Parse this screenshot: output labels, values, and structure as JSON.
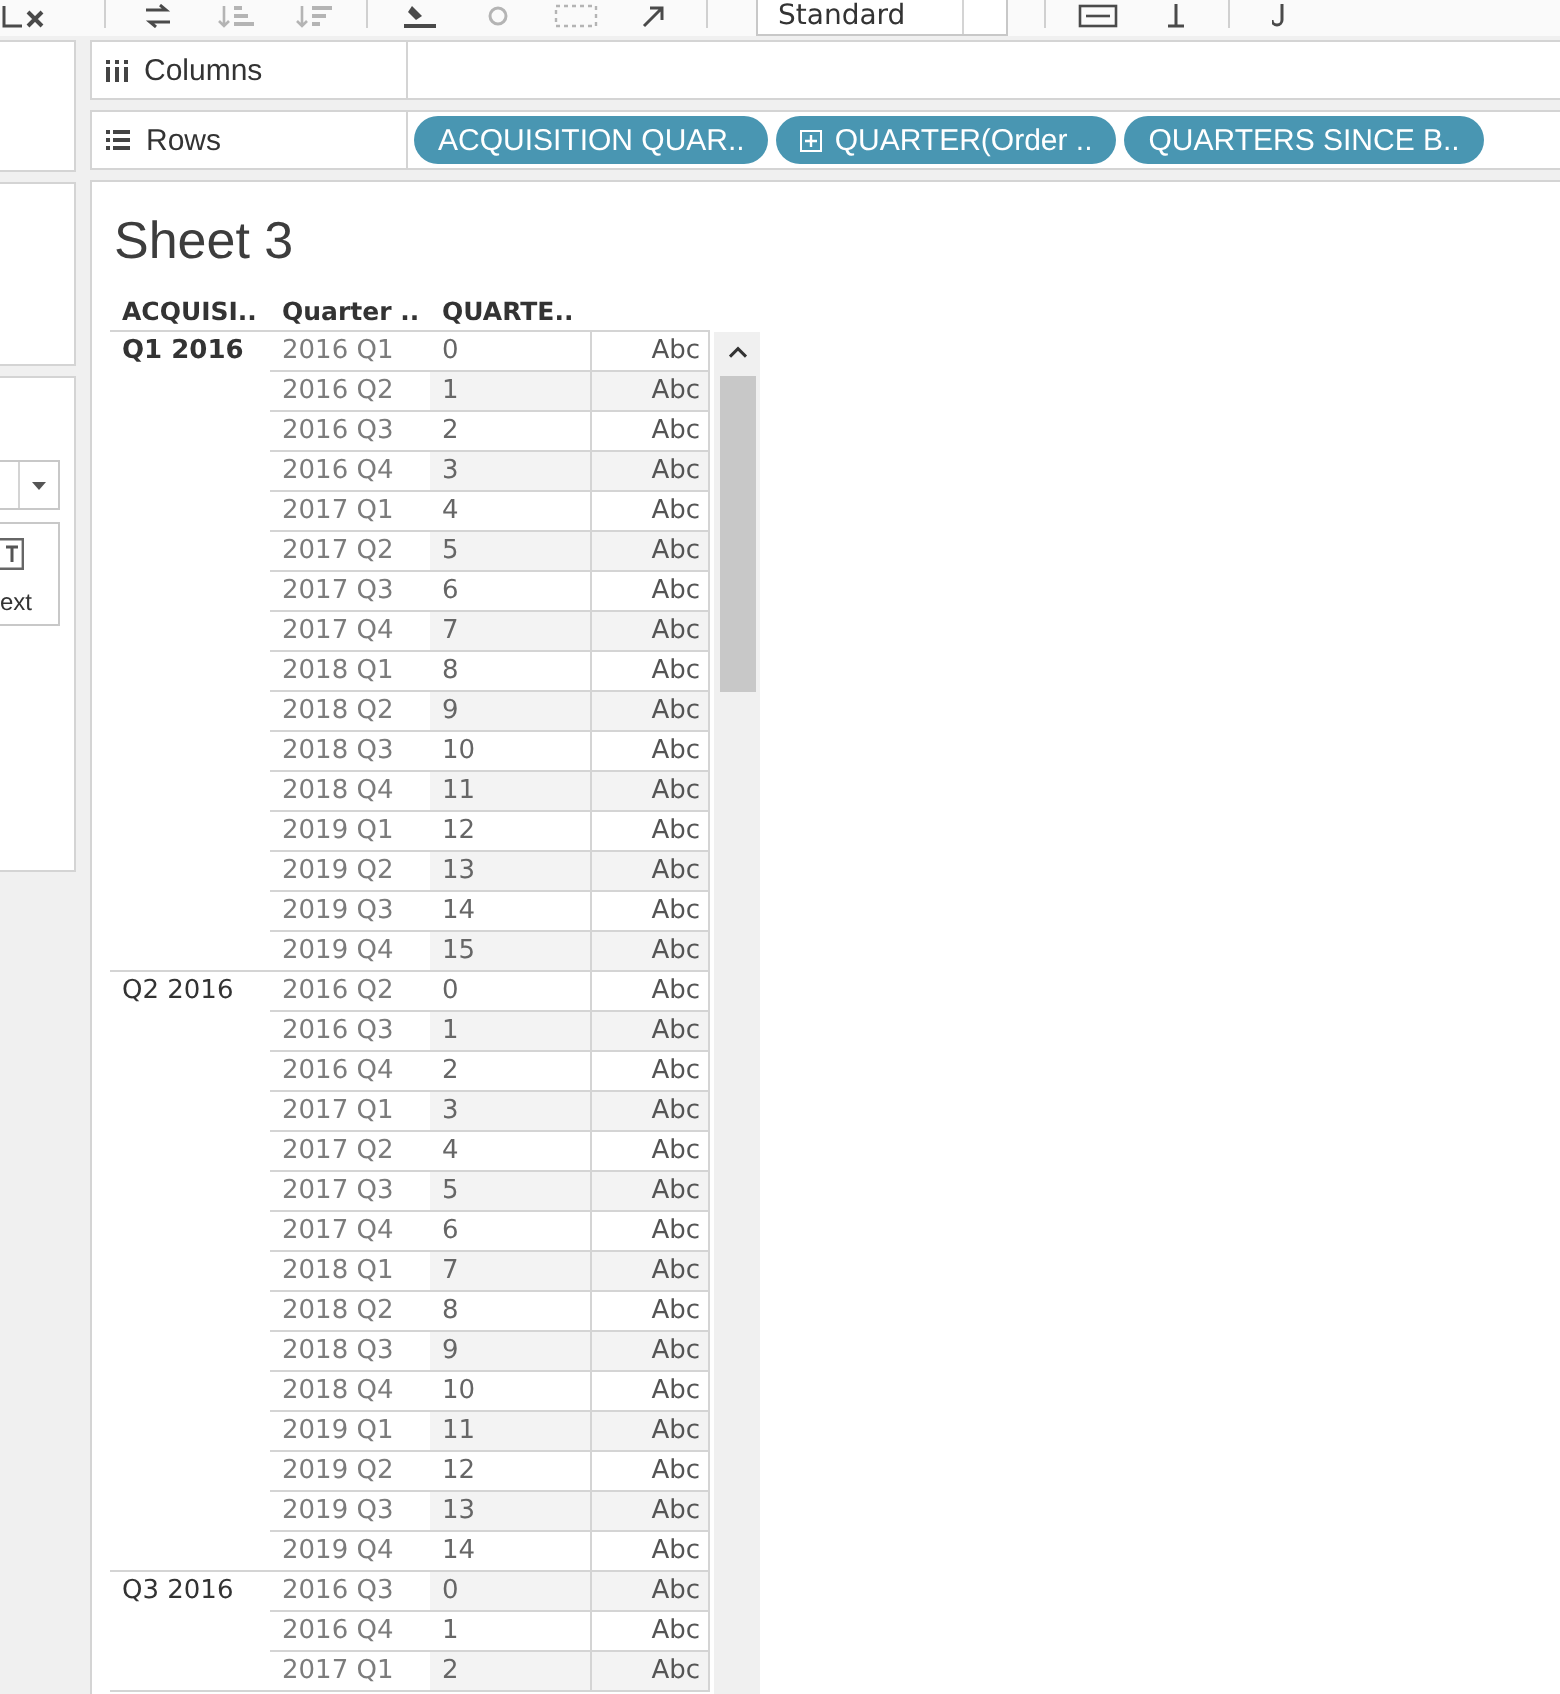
{
  "toolbar": [
    {
      "kind": "buttons",
      "buttons": [
        {
          "disabled": false
        }
      ]
    },
    {
      "kind": "buttons",
      "buttons": [
        {
          "disabled": false
        },
        {
          "disabled": true
        },
        {
          "disabled": true
        }
      ]
    },
    {
      "kind": "buttons",
      "buttons": [
        {
          "disabled": false
        },
        {
          "disabled": true
        },
        {
          "disabled": true
        },
        {
          "disabled": false
        }
      ]
    },
    {
      "kind": "dropdown",
      "value": "Standard"
    },
    {
      "kind": "buttons",
      "buttons": [
        {
          "disabled": false
        },
        {
          "disabled": false
        }
      ]
    },
    {
      "kind": "buttons",
      "buttons": [
        {
          "disabled": false
        }
      ]
    }
  ],
  "marks_card": {
    "buttons": [
      {
        "label": "ext"
      }
    ]
  },
  "shelves": [
    {
      "kind": "columns",
      "label": "Columns"
    },
    {
      "kind": "rows",
      "label": "Rows",
      "pills": [
        {
          "label": "ACQUISITION QUAR..",
          "drillable": false
        },
        {
          "label": "QUARTER(Order ..",
          "drillable": true
        },
        {
          "label": "QUARTERS SINCE B..",
          "drillable": false
        }
      ]
    }
  ],
  "sheet": {
    "title": "Sheet 3",
    "headers": [
      "ACQUISI..",
      "Quarter ..",
      "QUARTE.."
    ],
    "groups": [
      {
        "label": "Q1 2016",
        "selected": true,
        "rows": [
          {
            "column_2": "2016 Q1",
            "column_3": "0",
            "column_4": "Abc"
          },
          {
            "column_2": "2016 Q2",
            "column_3": "1",
            "column_4": "Abc"
          },
          {
            "column_2": "2016 Q3",
            "column_3": "2",
            "column_4": "Abc"
          },
          {
            "column_2": "2016 Q4",
            "column_3": "3",
            "column_4": "Abc"
          },
          {
            "column_2": "2017 Q1",
            "column_3": "4",
            "column_4": "Abc"
          },
          {
            "column_2": "2017 Q2",
            "column_3": "5",
            "column_4": "Abc"
          },
          {
            "column_2": "2017 Q3",
            "column_3": "6",
            "column_4": "Abc"
          },
          {
            "column_2": "2017 Q4",
            "column_3": "7",
            "column_4": "Abc"
          },
          {
            "column_2": "2018 Q1",
            "column_3": "8",
            "column_4": "Abc"
          },
          {
            "column_2": "2018 Q2",
            "column_3": "9",
            "column_4": "Abc"
          },
          {
            "column_2": "2018 Q3",
            "column_3": "10",
            "column_4": "Abc"
          },
          {
            "column_2": "2018 Q4",
            "column_3": "11",
            "column_4": "Abc"
          },
          {
            "column_2": "2019 Q1",
            "column_3": "12",
            "column_4": "Abc"
          },
          {
            "column_2": "2019 Q2",
            "column_3": "13",
            "column_4": "Abc"
          },
          {
            "column_2": "2019 Q3",
            "column_3": "14",
            "column_4": "Abc"
          },
          {
            "column_2": "2019 Q4",
            "column_3": "15",
            "column_4": "Abc"
          }
        ]
      },
      {
        "label": "Q2 2016",
        "selected": false,
        "rows": [
          {
            "column_2": "2016 Q2",
            "column_3": "0",
            "column_4": "Abc"
          },
          {
            "column_2": "2016 Q3",
            "column_3": "1",
            "column_4": "Abc"
          },
          {
            "column_2": "2016 Q4",
            "column_3": "2",
            "column_4": "Abc"
          },
          {
            "column_2": "2017 Q1",
            "column_3": "3",
            "column_4": "Abc"
          },
          {
            "column_2": "2017 Q2",
            "column_3": "4",
            "column_4": "Abc"
          },
          {
            "column_2": "2017 Q3",
            "column_3": "5",
            "column_4": "Abc"
          },
          {
            "column_2": "2017 Q4",
            "column_3": "6",
            "column_4": "Abc"
          },
          {
            "column_2": "2018 Q1",
            "column_3": "7",
            "column_4": "Abc"
          },
          {
            "column_2": "2018 Q2",
            "column_3": "8",
            "column_4": "Abc"
          },
          {
            "column_2": "2018 Q3",
            "column_3": "9",
            "column_4": "Abc"
          },
          {
            "column_2": "2018 Q4",
            "column_3": "10",
            "column_4": "Abc"
          },
          {
            "column_2": "2019 Q1",
            "column_3": "11",
            "column_4": "Abc"
          },
          {
            "column_2": "2019 Q2",
            "column_3": "12",
            "column_4": "Abc"
          },
          {
            "column_2": "2019 Q3",
            "column_3": "13",
            "column_4": "Abc"
          },
          {
            "column_2": "2019 Q4",
            "column_3": "14",
            "column_4": "Abc"
          }
        ]
      },
      {
        "label": "Q3 2016",
        "selected": false,
        "rows": [
          {
            "column_2": "2016 Q3",
            "column_3": "0",
            "column_4": "Abc"
          },
          {
            "column_2": "2016 Q4",
            "column_3": "1",
            "column_4": "Abc"
          },
          {
            "column_2": "2017 Q1",
            "column_3": "2",
            "column_4": "Abc"
          }
        ]
      }
    ]
  }
}
